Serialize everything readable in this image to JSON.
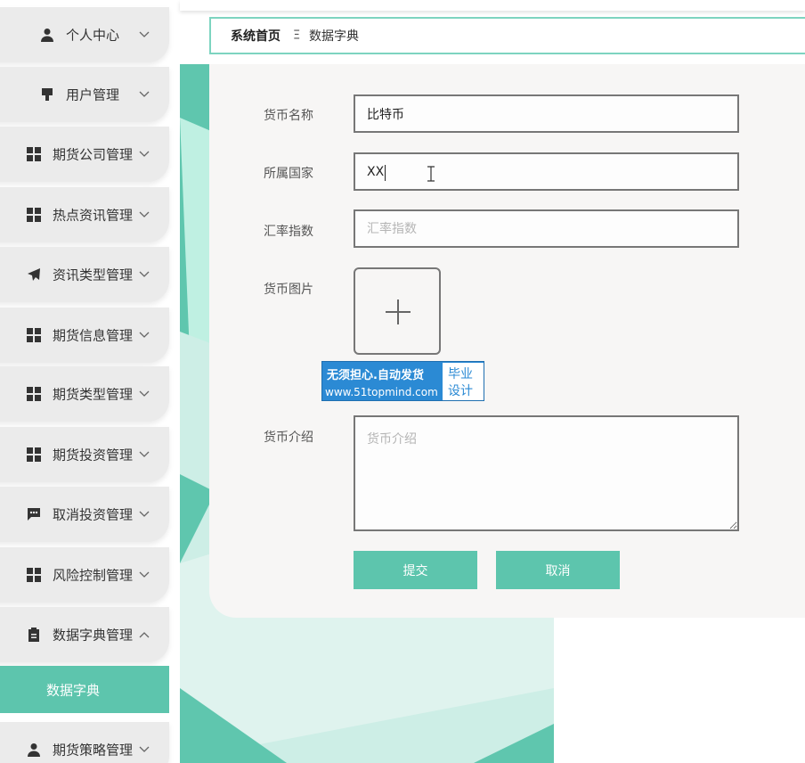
{
  "sidebar": {
    "items": [
      {
        "label": "个人中心",
        "icon": "user-icon"
      },
      {
        "label": "用户管理",
        "icon": "pin-icon"
      },
      {
        "label": "期货公司管理",
        "icon": "grid-icon"
      },
      {
        "label": "热点资讯管理",
        "icon": "grid-icon"
      },
      {
        "label": "资讯类型管理",
        "icon": "send-icon"
      },
      {
        "label": "期货信息管理",
        "icon": "grid-icon"
      },
      {
        "label": "期货类型管理",
        "icon": "grid-icon"
      },
      {
        "label": "期货投资管理",
        "icon": "grid-icon"
      },
      {
        "label": "取消投资管理",
        "icon": "message-icon"
      },
      {
        "label": "风险控制管理",
        "icon": "grid-icon"
      },
      {
        "label": "数据字典管理",
        "icon": "clipboard-icon"
      },
      {
        "label": "期货策略管理",
        "icon": "user-icon"
      }
    ],
    "active_sub_item": "数据字典"
  },
  "breadcrumb": {
    "home": "系统首页",
    "separator": "Ξ",
    "current": "数据字典"
  },
  "form": {
    "currency_name": {
      "label": "货币名称",
      "value": "比特币"
    },
    "country": {
      "label": "所属国家",
      "value": "XX"
    },
    "exchange_rate": {
      "label": "汇率指数",
      "placeholder": "汇率指数"
    },
    "image": {
      "label": "货币图片"
    },
    "intro": {
      "label": "货币介绍",
      "placeholder": "货币介绍"
    },
    "submit_label": "提交",
    "cancel_label": "取消"
  },
  "watermark": {
    "line1": "无须担心.自动发货",
    "line2": "www.51topmind.com",
    "badge1": "毕业",
    "badge2": "设计"
  },
  "colors": {
    "accent": "#5dc5ad",
    "sidebar_item_bg": "#ebebeb",
    "panel_bg": "#f7f6f5"
  }
}
